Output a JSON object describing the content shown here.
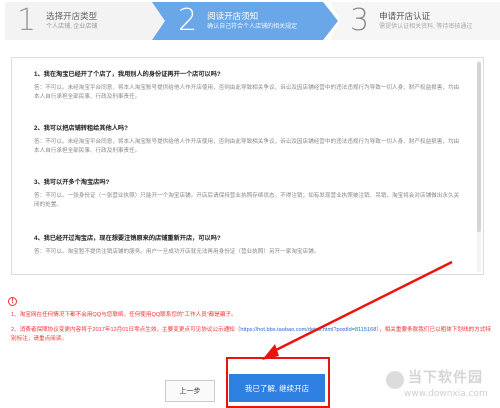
{
  "steps": [
    {
      "num": "1",
      "title": "选择开店类型",
      "sub": "个人店铺, 企业店铺"
    },
    {
      "num": "2",
      "title": "阅读开店须知",
      "sub": "确认自己符合个人店铺的相关规定"
    },
    {
      "num": "3",
      "title": "申请开店认证",
      "sub": "需提供认证相关资料, 等待审核通过"
    }
  ],
  "agreement": [
    {
      "q": "1、我在淘宝已经开了个店了，我用别人的身份证再开一个店可以吗?",
      "a": "答：不可以。未经淘宝平台同意，将本人淘宝账号提供给他人作开店使用，否则由此导致相关争议，诉讼及因店铺经营中的违法违规行为导致一切人身、财产权益损害，均由本人自行承担全部民事、行政及刑事责任。"
    },
    {
      "q": "2、我可以把店铺转租给其他人吗?",
      "a": "答：不可以。未经淘宝平台同意，将本人淘宝账号提供给他人作开店使用，否则由此导致相关争议，诉讼及因店铺经营中的违法违规行为导致一切人身、财产权益损害，均由本人自行承担全部民事、行政及刑事责任。"
    },
    {
      "q": "3、我可以开多个淘宝店吗?",
      "a": "答：不可以。一张身份证（一张营业执照）只能开一个淘宝店铺。开店后请保持营业执照存续状态，不得注销；如有发现营业执照被注销、吊销，淘宝将会对店铺做出永久关闭的处置。"
    },
    {
      "q": "4、我已经开过淘宝店，现在想要注销原来的店铺重新开店，可以吗?",
      "a": "答：不可以。淘宝暂不提供注销店铺的服务。用户一旦成功开店就无法再用身份证（营业执照）另开一家淘宝店铺。"
    }
  ],
  "notes": {
    "note1": "1、淘宝网在任何情况下都不会用QQ与您联络，任何使用QQ联系您的“工作人员”都是骗子。",
    "note2_pre": "2、消费者保障协议变更内容将于2017年12月01日零点生效，主要变更点可见协议公示通知（",
    "note2_link": "https://hot.bbs.taobao.com/detail.html?postId=8115168",
    "note2_post": "），相关重要条款我们已以粗体下划线的方式特别标注，请重点阅读。"
  },
  "buttons": {
    "prev": "上一步",
    "next": "我已了解, 继续开店"
  },
  "watermark": {
    "cn": "当下软件园",
    "url": "www.downxia.com"
  },
  "colors": {
    "accent": "#2d7fe0",
    "step_active": "#6aa7e8",
    "warn": "#e33",
    "highlight": "#e8150f"
  }
}
